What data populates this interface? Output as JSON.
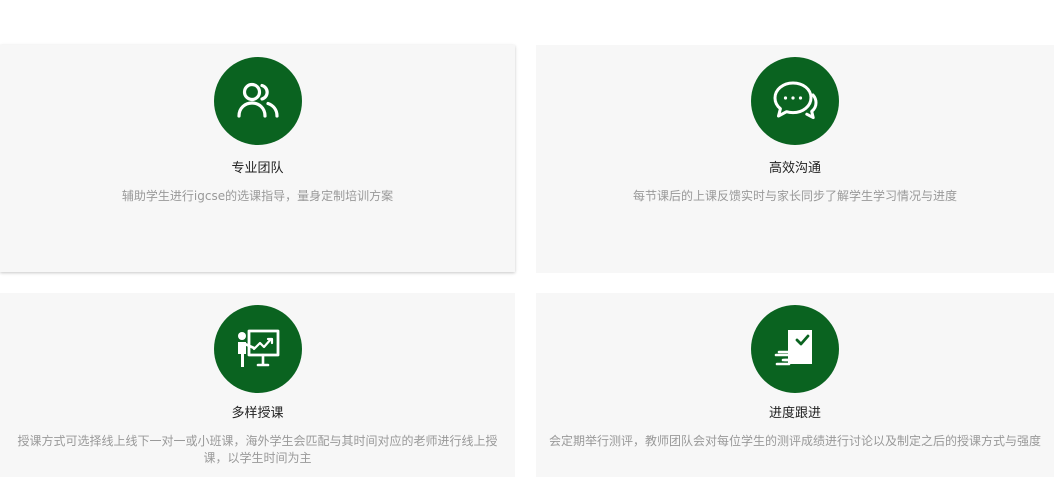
{
  "colors": {
    "accent": "#0a6320",
    "card_bg": "#f7f7f7",
    "title": "#222222",
    "desc": "#999999"
  },
  "features": [
    {
      "icon": "team-icon",
      "title": "专业团队",
      "desc": "辅助学生进行igcse的选课指导，量身定制培训方案"
    },
    {
      "icon": "chat-icon",
      "title": "高效沟通",
      "desc": "每节课后的上课反馈实时与家长同步了解学生学习情况与进度"
    },
    {
      "icon": "teacher-board-icon",
      "title": "多样授课",
      "desc": "授课方式可选择线上线下一对一或小班课，海外学生会匹配与其时间对应的老师进行线上授课，以学生时间为主"
    },
    {
      "icon": "progress-check-icon",
      "title": "进度跟进",
      "desc": "会定期举行测评，教师团队会对每位学生的测评成绩进行讨论以及制定之后的授课方式与强度"
    }
  ]
}
